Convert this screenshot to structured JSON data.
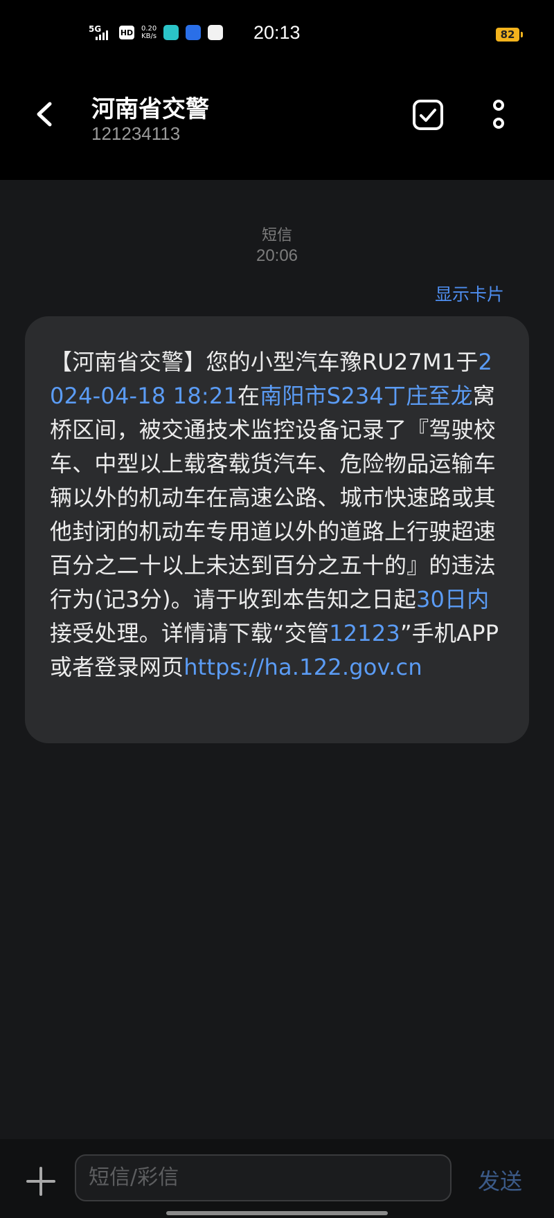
{
  "status": {
    "network": "5G",
    "hd": "HD",
    "speed_value": "0.20",
    "speed_unit": "KB/s",
    "time": "20:13",
    "battery": "82"
  },
  "header": {
    "title": "河南省交警",
    "number": "121234113"
  },
  "thread": {
    "msg_type": "短信",
    "msg_time": "20:06",
    "show_card": "显示卡片"
  },
  "message": {
    "s1": "【河南省交警】您的小型汽车豫RU27M1于",
    "date": "2024-04-18 18:21",
    "s2": "在",
    "location": "南阳市S234丁庄至龙",
    "s3": "窝桥区间，被交通技术监控设备记录了『驾驶校车、中型以上载客载货汽车、危险物品运输车辆以外的机动车在高速公路、城市快速路或其他封闭的机动车专用道以外的道路上行驶超速百分之二十以上未达到百分之五十的』的违法行为(记3分)。请于收到本告知之日起",
    "deadline": "30日内",
    "s4": "接受处理。详情请下载“交管",
    "app_num": "12123",
    "s5": "”手机APP或者登录网页",
    "url": "https://ha.122.gov.cn"
  },
  "composer": {
    "placeholder": "短信/彩信",
    "send": "发送"
  },
  "colors": {
    "link": "#5b9cf5",
    "bubble": "#2b2c2e",
    "battery": "#f3b31d"
  }
}
